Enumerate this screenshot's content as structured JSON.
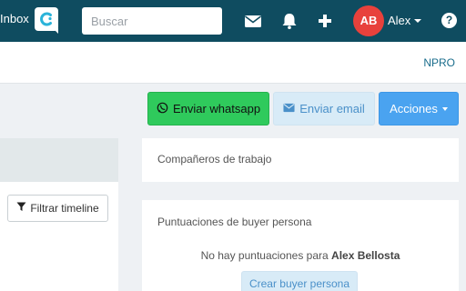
{
  "nav": {
    "brand": "Inbox",
    "search_placeholder": "Buscar",
    "icons": [
      "envelope-icon",
      "bell-icon",
      "plus-icon",
      "help-icon"
    ],
    "user": {
      "initials": "AB",
      "name": "Alex"
    },
    "help_glyph": "?"
  },
  "subheader": {
    "right_link": "NPRO"
  },
  "actions": {
    "whatsapp": "Enviar whatsapp",
    "email": "Enviar email",
    "menu": "Acciones"
  },
  "left_panel": {
    "filter_button": "Filtrar timeline"
  },
  "coworkers": {
    "title": "Compañeros de trabajo"
  },
  "buyer_persona": {
    "title": "Puntuaciones de buyer persona",
    "empty_text": "No hay puntuaciones para",
    "empty_name": "Alex Bellosta",
    "create_button": "Crear buyer persona"
  },
  "colors": {
    "nav_bg": "#0f4c60",
    "whatsapp_green": "#2fca5c",
    "avatar_red": "#e8413c",
    "action_blue": "#4aa3f0",
    "light_blue": "#d8ebf7"
  }
}
